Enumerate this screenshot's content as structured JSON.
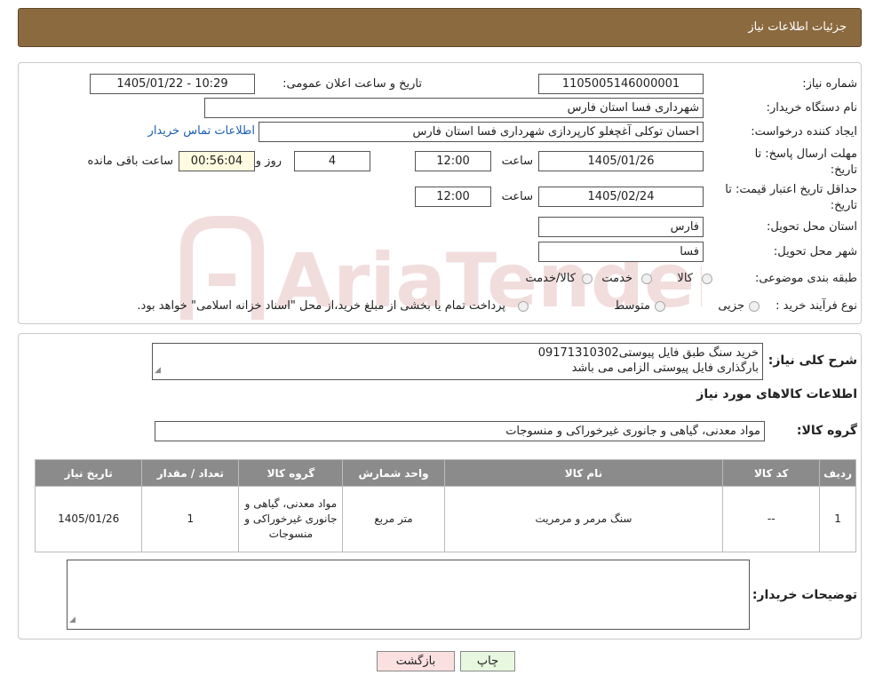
{
  "header": {
    "title": "جزئیات اطلاعات نیاز"
  },
  "watermark": {
    "text": "AriaTender.neT",
    "color": "#b03030"
  },
  "form": {
    "need_number_label": "شماره نیاز:",
    "need_number_value": "1105005146000001",
    "announce_label": "تاریخ و ساعت اعلان عمومی:",
    "announce_value": "1405/01/22 - 10:29",
    "buyer_org_label": "نام دستگاه خریدار:",
    "buyer_org_value": "شهرداری فسا استان فارس",
    "requester_label": "ایجاد کننده درخواست:",
    "requester_value": "احسان توکلی آغچغلو کارپردازی شهرداری فسا استان فارس",
    "contact_link": "اطلاعات تماس خریدار",
    "deadline_label_line1": "مهلت ارسال پاسخ: تا",
    "deadline_label_line2": "تاریخ:",
    "deadline_date": "1405/01/26",
    "time_label": "ساعت",
    "deadline_time": "12:00",
    "days_value": "4",
    "days_label": "روز و",
    "remaining_time": "00:56:04",
    "remaining_label": "ساعت باقی مانده",
    "validity_label_line1": "حداقل تاریخ اعتبار قیمت: تا",
    "validity_label_line2": "تاریخ:",
    "validity_date": "1405/02/24",
    "validity_time_label": "ساعت",
    "validity_time": "12:00",
    "province_label": "استان محل تحویل:",
    "province_value": "فارس",
    "city_label": "شهر محل تحویل:",
    "city_value": "فسا",
    "category_label": "طبقه بندی موضوعی:",
    "category_options": [
      "کالا",
      "خدمت",
      "کالا/خدمت"
    ],
    "purchase_type_label": "نوع فرآیند خرید :",
    "purchase_type_options": [
      "جزیی",
      "متوسط"
    ],
    "purchase_note": "پرداخت تمام یا بخشی از مبلغ خرید،از محل \"اسناد خزانه اسلامی\" خواهد بود."
  },
  "summary": {
    "description_label": "شرح کلی نیاز:",
    "description_line1": "خرید سنگ طبق فایل پیوستی09171310302",
    "description_line2": "بارگذاری فایل پیوستی الزامی می باشد",
    "items_heading": "اطلاعات کالاهای مورد نیاز",
    "group_label": "گروه کالا:",
    "group_value": "مواد معدنی، گیاهی و جانوری غیرخوراکی و منسوجات",
    "table_headers": [
      "ردیف",
      "کد کالا",
      "نام کالا",
      "واحد شمارش",
      "گروه کالا",
      "تعداد / مقدار",
      "تاریخ نیاز"
    ],
    "rows": [
      [
        "1",
        "--",
        "سنگ مرمر و مرمریت",
        "متر مربع",
        "مواد معدنی، گیاهی و جانوری غیرخوراکی و منسوجات",
        "1",
        "1405/01/26"
      ]
    ],
    "buyer_notes_label": "توضیحات خریدار:",
    "buyer_notes_value": ""
  },
  "buttons": {
    "print": "چاپ",
    "back": "بازگشت"
  }
}
